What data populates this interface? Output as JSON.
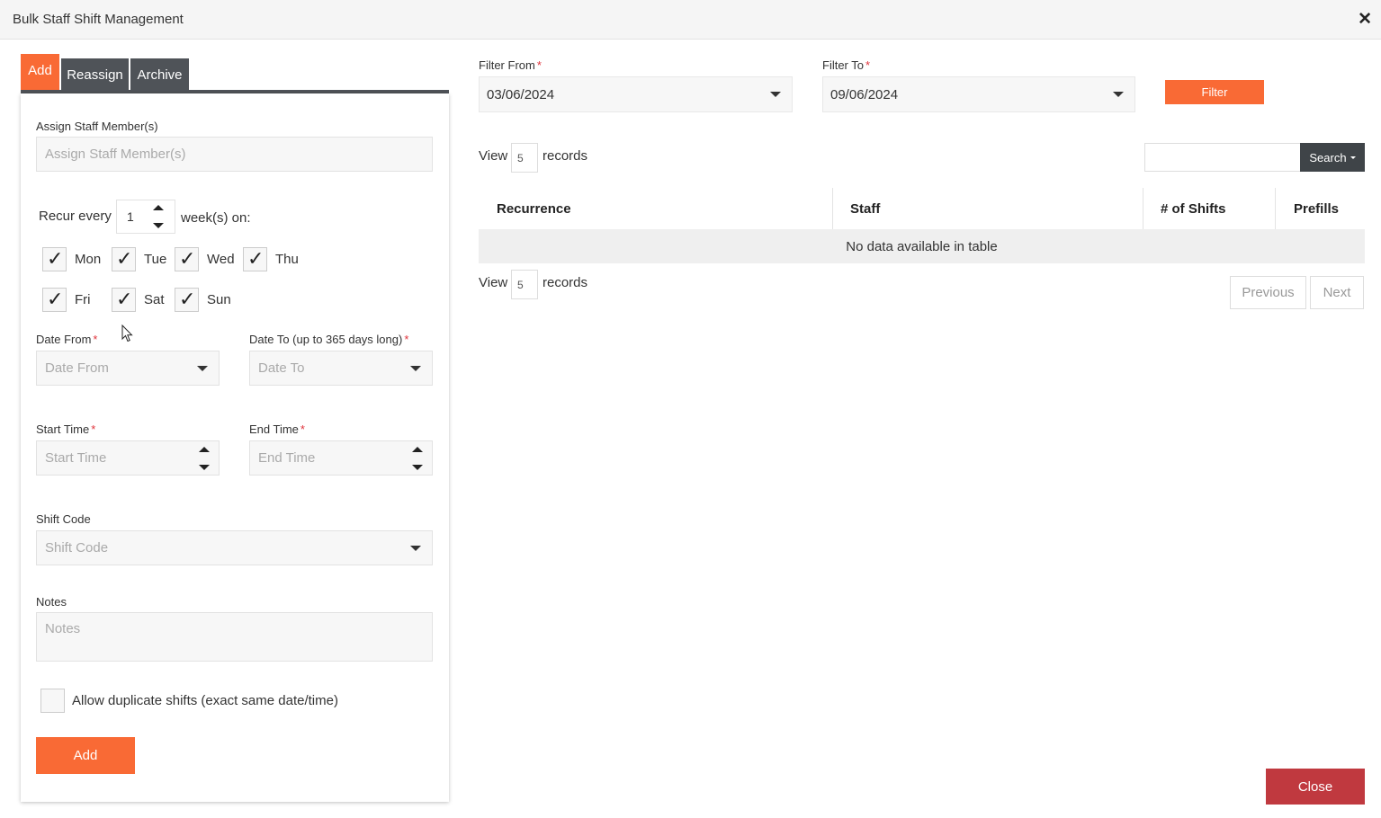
{
  "modal": {
    "title": "Bulk Staff Shift Management",
    "close_icon": "close-icon"
  },
  "tabs": [
    {
      "label": "Add",
      "active": true
    },
    {
      "label": "Reassign",
      "active": false
    },
    {
      "label": "Archive",
      "active": false
    }
  ],
  "form": {
    "assign_label": "Assign Staff Member(s)",
    "assign_placeholder": "Assign Staff Member(s)",
    "recur_prefix": "Recur every",
    "recur_value": "1",
    "recur_suffix": "week(s) on:",
    "days": [
      {
        "label": "Mon",
        "checked": true
      },
      {
        "label": "Tue",
        "checked": true
      },
      {
        "label": "Wed",
        "checked": true
      },
      {
        "label": "Thu",
        "checked": true
      },
      {
        "label": "Fri",
        "checked": true
      },
      {
        "label": "Sat",
        "checked": true
      },
      {
        "label": "Sun",
        "checked": true
      }
    ],
    "date_from_label": "Date From",
    "date_from_placeholder": "Date From",
    "date_to_label": "Date To (up to 365 days long)",
    "date_to_placeholder": "Date To",
    "start_time_label": "Start Time",
    "start_time_placeholder": "Start Time",
    "end_time_label": "End Time",
    "end_time_placeholder": "End Time",
    "shift_code_label": "Shift Code",
    "shift_code_placeholder": "Shift Code",
    "notes_label": "Notes",
    "notes_placeholder": "Notes",
    "duplicate_label": "Allow duplicate shifts (exact same date/time)",
    "duplicate_checked": false,
    "add_button": "Add",
    "required_mark": "*"
  },
  "filter": {
    "from_label": "Filter From",
    "from_value": "03/06/2024",
    "to_label": "Filter To",
    "to_value": "09/06/2024",
    "button": "Filter"
  },
  "table": {
    "view_prefix": "View",
    "view_count": "5",
    "view_suffix": "records",
    "search_button": "Search",
    "columns": [
      "Recurrence",
      "Staff",
      "# of Shifts",
      "Prefills"
    ],
    "empty_message": "No data available in table",
    "previous": "Previous",
    "next": "Next"
  },
  "footer": {
    "close_button": "Close"
  },
  "colors": {
    "accent": "#f96a35",
    "dark_tab": "#4f5358",
    "close_button": "#c0393f"
  }
}
